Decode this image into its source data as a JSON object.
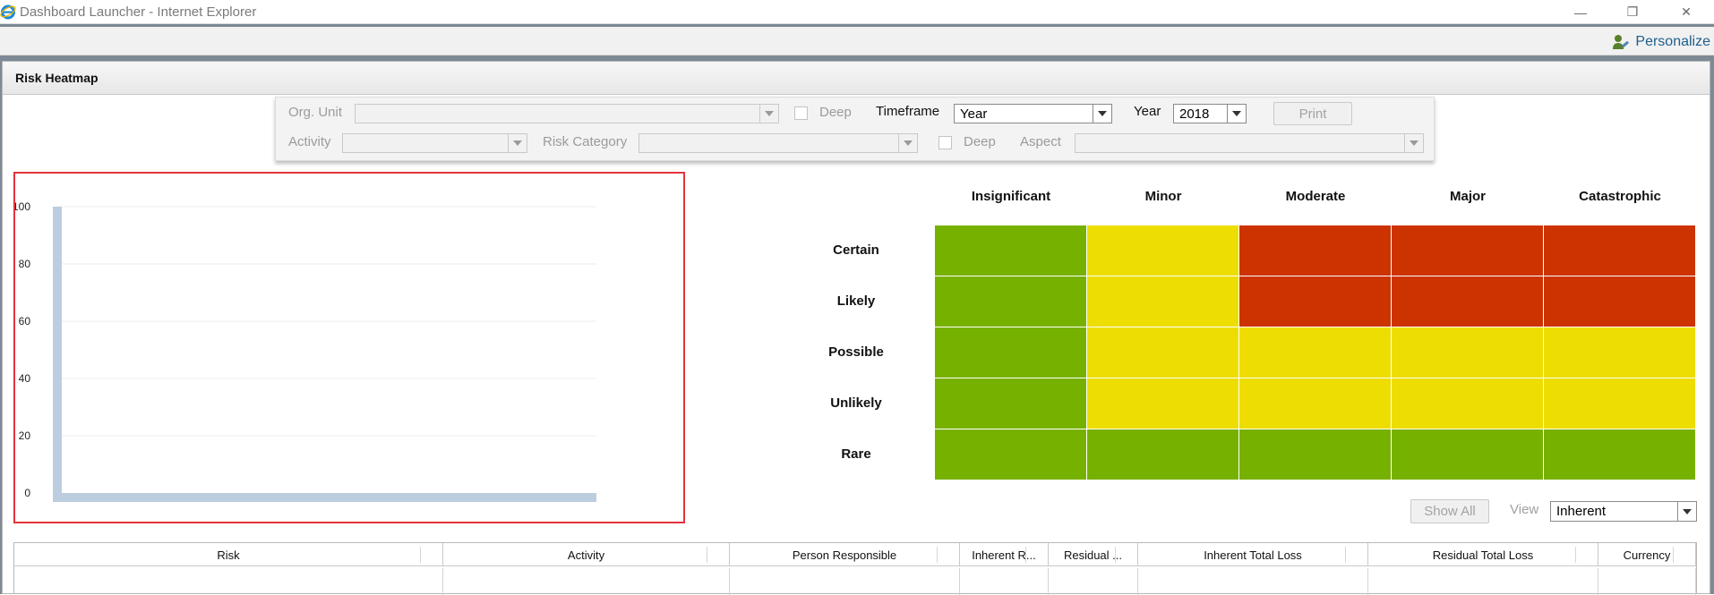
{
  "window": {
    "title": "Dashboard Launcher - Internet Explorer",
    "minimize_glyph": "—",
    "restore_glyph": "❐",
    "close_glyph": "✕"
  },
  "toolbar": {
    "personalize_label": "Personalize",
    "personalize_icon": "user-wrench-icon"
  },
  "panel": {
    "title": "Risk Heatmap"
  },
  "filters": {
    "org_unit_label": "Org. Unit",
    "org_unit_value": "",
    "deep_label_1": "Deep",
    "timeframe_label": "Timeframe",
    "timeframe_value": "Year",
    "year_label": "Year",
    "year_value": "2018",
    "print_label": "Print",
    "activity_label": "Activity",
    "activity_value": "",
    "risk_category_label": "Risk Category",
    "risk_category_value": "",
    "deep_label_2": "Deep",
    "aspect_label": "Aspect",
    "aspect_value": ""
  },
  "chart_data": {
    "type": "bar",
    "categories": [
      ""
    ],
    "values": [
      100
    ],
    "title": "",
    "xlabel": "",
    "ylabel": "",
    "ylim": [
      0,
      100
    ],
    "yticks": [
      "0",
      "20",
      "40",
      "60",
      "80",
      "100"
    ],
    "grid": true,
    "bar_color": "#bccde0"
  },
  "heatmap": {
    "columns": [
      "Insignificant",
      "Minor",
      "Moderate",
      "Major",
      "Catastrophic"
    ],
    "rows": [
      "Certain",
      "Likely",
      "Possible",
      "Unlikely",
      "Rare"
    ],
    "cells": [
      [
        "green",
        "yellow",
        "red",
        "red",
        "red"
      ],
      [
        "green",
        "yellow",
        "red",
        "red",
        "red"
      ],
      [
        "green",
        "yellow",
        "yellow",
        "yellow",
        "yellow"
      ],
      [
        "green",
        "yellow",
        "yellow",
        "yellow",
        "yellow"
      ],
      [
        "green",
        "green",
        "green",
        "green",
        "green"
      ]
    ],
    "colors": {
      "green": "#77b100",
      "yellow": "#eedd00",
      "red": "#cc3300"
    }
  },
  "controls": {
    "show_all_label": "Show All",
    "view_label": "View",
    "view_value": "Inherent"
  },
  "grid": {
    "columns": [
      "Risk",
      "Activity",
      "Person Responsible",
      "Inherent R...",
      "Residual ...",
      "Inherent Total Loss",
      "Residual Total Loss",
      "Currency"
    ]
  }
}
